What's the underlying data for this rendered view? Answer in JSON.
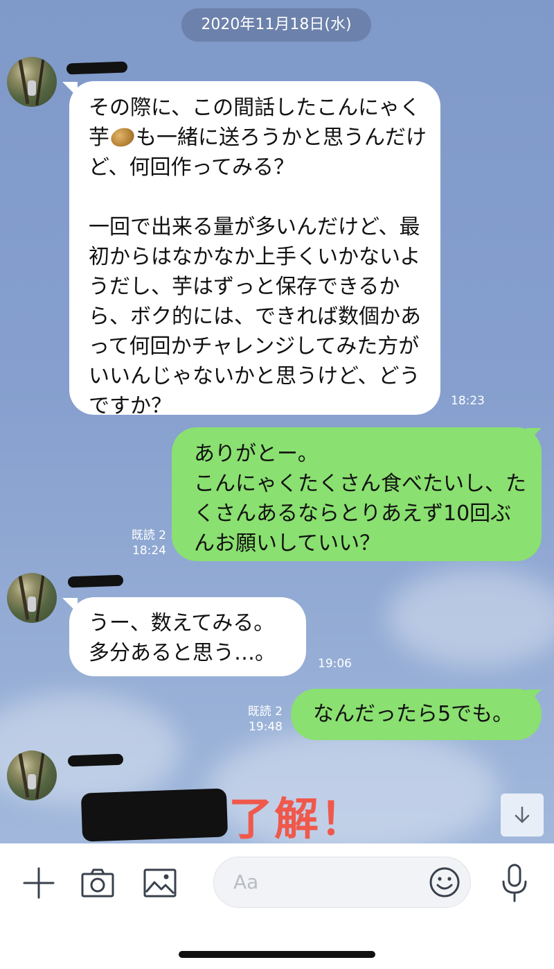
{
  "date_separator": "2020年11月18日(水)",
  "messages": [
    {
      "direction": "incoming",
      "text_before_emoji": "その際に、この間話したこんにゃく芋",
      "emoji": "potato",
      "text_after_emoji": "も一緒に送ろうかと思うんだけど、何回作ってみる？\n\n一回で出来る量が多いんだけど、最初からはなかなか上手くいかないようだし、芋はずっと保存できるから、ボク的には、できれば数個かあって何回かチャレンジしてみた方がいいんじゃないかと思うけど、どうですか？",
      "time": "18:23"
    },
    {
      "direction": "outgoing",
      "text": "ありがとー。\nこんにゃくたくさん食べたいし、たくさんあるならとりあえず10回ぶんお願いしていい？",
      "read": "既読 2",
      "time": "18:24"
    },
    {
      "direction": "incoming",
      "text": "うー、数えてみる。\n多分あると思う…。",
      "time": "19:06"
    },
    {
      "direction": "outgoing",
      "text": "なんだったら5でも。",
      "read": "既読 2",
      "time": "19:48"
    }
  ],
  "sticker_text": "了解！",
  "input": {
    "placeholder": "Aa"
  },
  "icons": {
    "plus": "plus-icon",
    "camera": "camera-icon",
    "image": "image-icon",
    "emoji": "smiley-icon",
    "mic": "microphone-icon",
    "scroll": "arrow-down-icon"
  },
  "colors": {
    "incoming_bubble": "#ffffff",
    "outgoing_bubble": "#8ae070",
    "sticker_text": "#f0584c"
  }
}
